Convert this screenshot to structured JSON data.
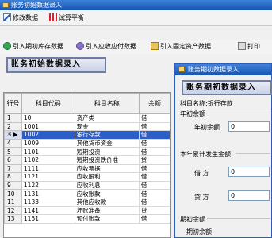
{
  "window_title": "账务初始数据录入",
  "toolbar": {
    "modify_label": "修改数据",
    "balance_label": "试算平衡"
  },
  "toolbar2": {
    "import_prev_label": "引入期初库存数据",
    "import_receivable_label": "引入应收应付数据",
    "import_fixed_label": "引入固定资产数据",
    "print_label": "打印"
  },
  "section_header": "账务初始数据录入",
  "grid": {
    "columns": [
      "行号",
      "科目代码",
      "科目名称",
      "余额"
    ],
    "rows": [
      {
        "num": "1",
        "code": "10",
        "name": "资产类",
        "dir": "借"
      },
      {
        "num": "2",
        "code": "1001",
        "name": "现金",
        "dir": "借"
      },
      {
        "num": "3",
        "code": "1002",
        "name": "银行存款",
        "dir": "借"
      },
      {
        "num": "4",
        "code": "1009",
        "name": "其他货币资金",
        "dir": "借"
      },
      {
        "num": "5",
        "code": "1101",
        "name": "短期投资",
        "dir": "借"
      },
      {
        "num": "6",
        "code": "1102",
        "name": "短期投资跌价准",
        "dir": "贷"
      },
      {
        "num": "7",
        "code": "1111",
        "name": "应收票据",
        "dir": "借"
      },
      {
        "num": "8",
        "code": "1121",
        "name": "应收股利",
        "dir": "借"
      },
      {
        "num": "9",
        "code": "1122",
        "name": "应收利息",
        "dir": "借"
      },
      {
        "num": "10",
        "code": "1131",
        "name": "应收账款",
        "dir": "借"
      },
      {
        "num": "11",
        "code": "1133",
        "name": "其他应收款",
        "dir": "借"
      },
      {
        "num": "12",
        "code": "1141",
        "name": "坏账准备",
        "dir": "贷"
      },
      {
        "num": "13",
        "code": "1151",
        "name": "预付账款",
        "dir": "借"
      }
    ],
    "selected_row": 2
  },
  "dialog": {
    "title": "账务期初数据录入",
    "header": "账务期初数据录入",
    "subject_label": "科目名称:银行存款",
    "opening_group": "年初余额",
    "opening_label": "年初余额",
    "opening_value": "0",
    "cumulative_group": "本年累计发生金额",
    "debit_label": "借    方",
    "debit_value": "0",
    "credit_label": "贷    方",
    "credit_value": "0",
    "period_group": "期初余额",
    "period_label": "期初余额"
  }
}
